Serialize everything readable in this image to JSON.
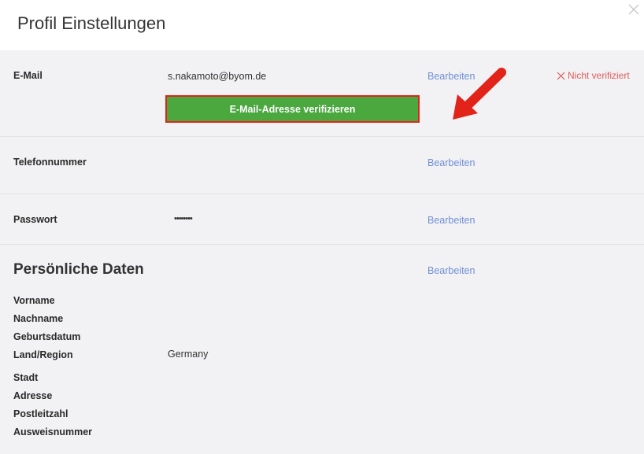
{
  "dialog": {
    "title": "Profil Einstellungen"
  },
  "email": {
    "label": "E-Mail",
    "value": "s.nakamoto@byom.de",
    "edit_label": "Bearbeiten",
    "status_text": "Nicht verifiziert",
    "verify_button_label": "E-Mail-Adresse verifizieren"
  },
  "phone": {
    "label": "Telefonnummer",
    "edit_label": "Bearbeiten"
  },
  "password": {
    "label": "Passwort",
    "value": "••••••••",
    "edit_label": "Bearbeiten"
  },
  "personal": {
    "title": "Persönliche Daten",
    "edit_label": "Bearbeiten",
    "fields": [
      {
        "label": "Vorname",
        "value": ""
      },
      {
        "label": "Nachname",
        "value": ""
      },
      {
        "label": "Geburtsdatum",
        "value": ""
      },
      {
        "label": "Land/Region",
        "value": "Germany"
      },
      {
        "label": "Stadt",
        "value": ""
      },
      {
        "label": "Adresse",
        "value": ""
      },
      {
        "label": "Postleitzahl",
        "value": ""
      },
      {
        "label": "Ausweisnummer",
        "value": ""
      }
    ]
  },
  "colors": {
    "link": "#6f8fd6",
    "error": "#e25b5b",
    "verify_button": "#4aa83e",
    "highlight": "#e2231a"
  }
}
